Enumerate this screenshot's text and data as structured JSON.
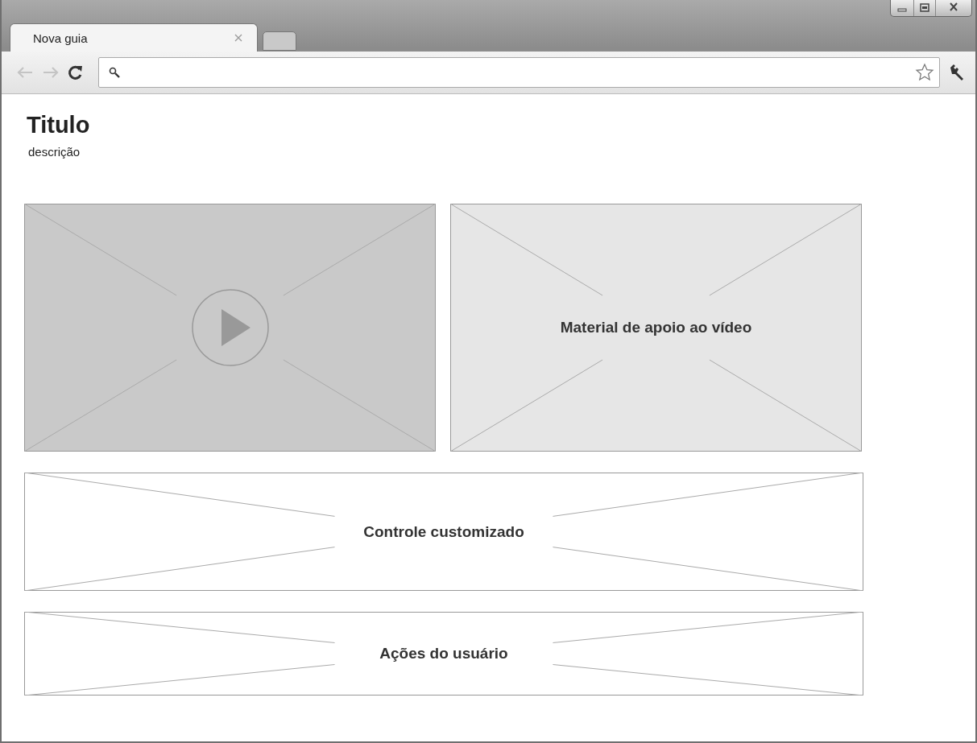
{
  "tabs": [
    {
      "label": "Nova guia",
      "selected": true
    }
  ],
  "page": {
    "title": "Titulo",
    "description": "descrição"
  },
  "panels": [
    [
      {
        "kind": "video"
      },
      {
        "kind": "image",
        "label": "Material de apoio ao vídeo"
      }
    ],
    [
      {
        "kind": "box",
        "label": "Controle customizado"
      }
    ],
    [
      {
        "kind": "box",
        "label": "Ações do usuário"
      }
    ]
  ]
}
